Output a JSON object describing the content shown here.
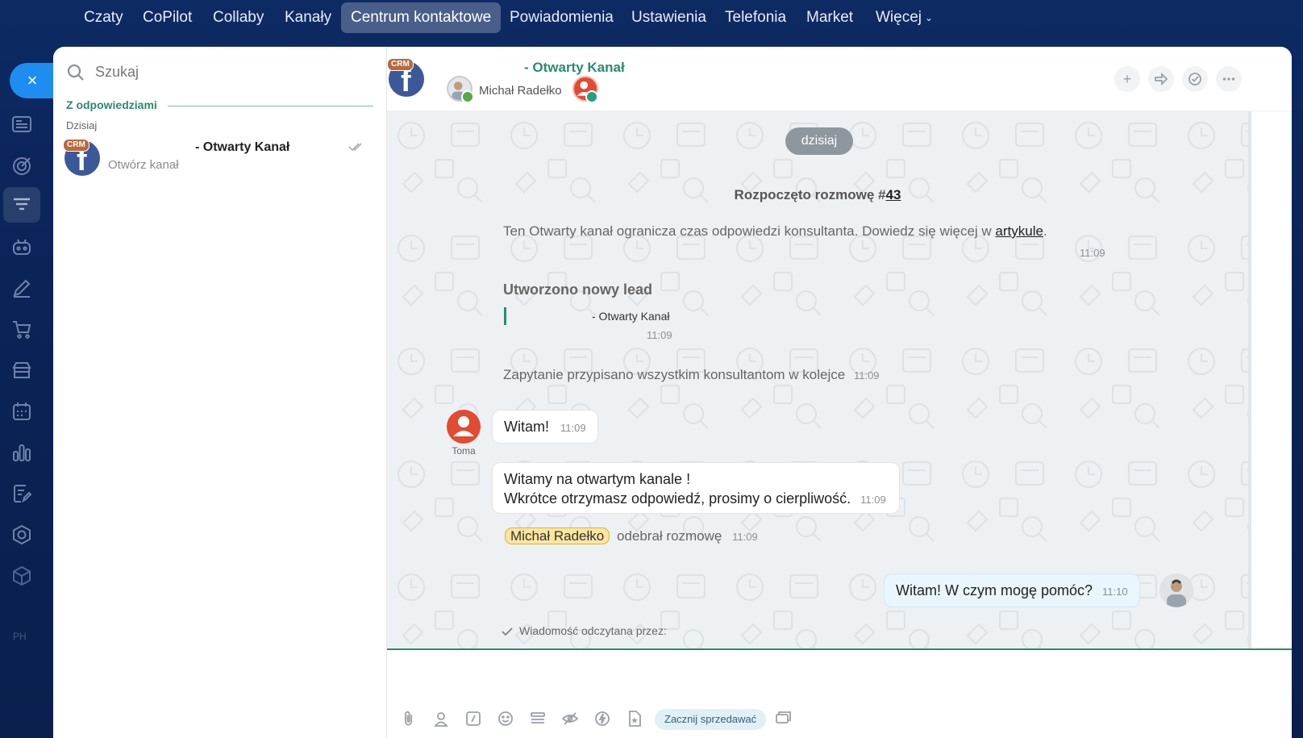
{
  "nav": {
    "items": [
      "Czaty",
      "CoPilot",
      "Collaby",
      "Kanały",
      "Centrum kontaktowe",
      "Powiadomienia",
      "Ustawienia",
      "Telefonia",
      "Market",
      "Więcej"
    ],
    "active_index": 4
  },
  "rail": {
    "close_label": "×",
    "faint_label": "PH"
  },
  "sidebar": {
    "search_placeholder": "Szukaj",
    "group_label": "Z odpowiedziami",
    "date_label": "Dzisiaj",
    "chat": {
      "crm_badge": "CRM",
      "avatar_letter": "f",
      "title": "- Otwarty Kanał",
      "subtitle": "Otwórz kanał"
    }
  },
  "header": {
    "crm_badge": "CRM",
    "avatar_letter": "f",
    "title": "- Otwarty Kanał",
    "member_name": "Michał Radełko"
  },
  "messages": {
    "date_pill": "dzisiaj",
    "started_prefix": "Rozpoczęto rozmowę #",
    "started_number": "43",
    "limit_text": "Ten Otwarty kanał ogranicza czas odpowiedzi konsultanta. Dowiedz się więcej w ",
    "limit_link": "artykule",
    "limit_suffix": ".",
    "limit_time": "11:09",
    "lead_title": "Utworzono nowy lead",
    "lead_name": "- Otwarty Kanał",
    "lead_time": "11:09",
    "assigned_text": "Zapytanie przypisano wszystkim konsultantom w kolejce",
    "assigned_time": "11:09",
    "client_name": "Toma",
    "client_msg": "Witam!",
    "client_msg_time": "11:09",
    "welcome_line1": "Witamy na otwartym kanale !",
    "welcome_line2": "Wkrótce otrzymasz odpowiedź, prosimy o cierpliwość.",
    "welcome_time": "11:09",
    "taken_user": "Michał Radełko",
    "taken_text": "odebrał rozmowę",
    "taken_time": "11:09",
    "agent_msg": "Witam! W czym mogę pomóc?",
    "agent_msg_time": "11:10",
    "read_text": "Wiadomość odczytana przez:"
  },
  "composer": {
    "sell_button": "Zacznij sprzedawać"
  },
  "colors": {
    "accent_green": "#2b8a6e",
    "nav_bg": "#0d2a63",
    "close_button": "#1d8ef0",
    "facebook": "#3b5998",
    "client_avatar": "#e24a32"
  }
}
